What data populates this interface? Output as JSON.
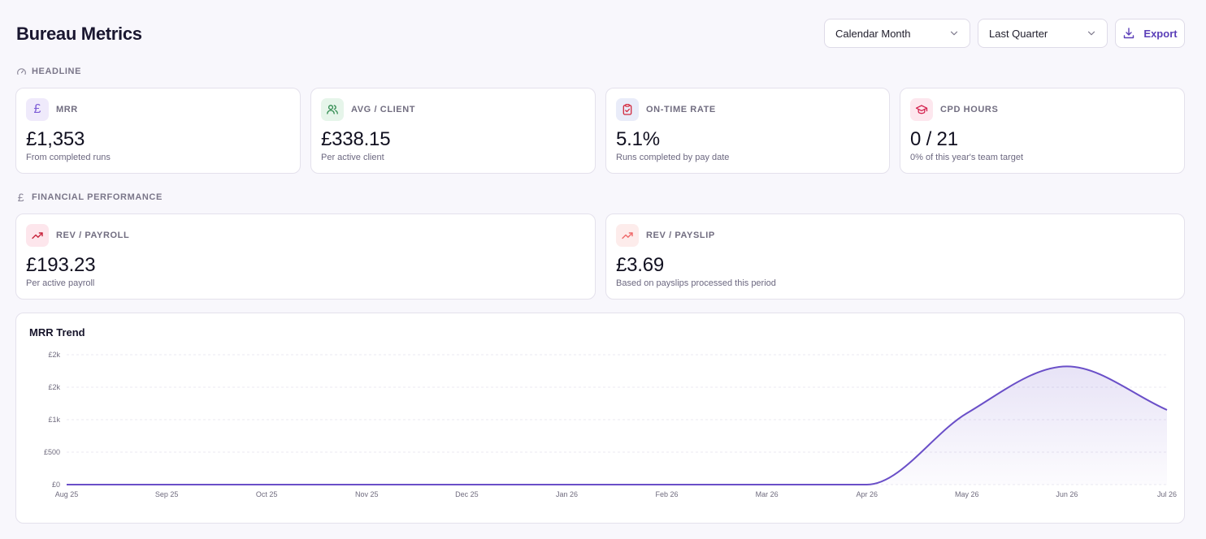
{
  "header": {
    "title": "Bureau Metrics",
    "period_select": "Calendar Month",
    "range_select": "Last Quarter",
    "export_label": "Export"
  },
  "sections": {
    "headline": "HEADLINE",
    "financial": "FINANCIAL PERFORMANCE"
  },
  "headline_cards": [
    {
      "label": "MRR",
      "value": "£1,353",
      "sub": "From completed runs",
      "icon": "pound-icon",
      "color": "#7c5cd6",
      "bg": "#efeafb"
    },
    {
      "label": "AVG / CLIENT",
      "value": "£338.15",
      "sub": "Per active client",
      "icon": "users-icon",
      "color": "#2e8a4e",
      "bg": "#e6f5ea"
    },
    {
      "label": "ON-TIME RATE",
      "value": "5.1%",
      "sub": "Runs completed by pay date",
      "icon": "clipboard-check-icon",
      "color": "#d1283d",
      "bg": "#e9ecf9"
    },
    {
      "label": "CPD HOURS",
      "value": "0 / 21",
      "sub": "0% of this year's team target",
      "icon": "graduation-cap-icon",
      "color": "#d42450",
      "bg": "#fde7ee"
    }
  ],
  "financial_cards": [
    {
      "label": "REV / PAYROLL",
      "value": "£193.23",
      "sub": "Per active payroll",
      "icon": "trending-up-icon",
      "color": "#c8243c",
      "bg": "#fde6ec"
    },
    {
      "label": "REV / PAYSLIP",
      "value": "£3.69",
      "sub": "Based on payslips processed this period",
      "icon": "trending-up-icon",
      "color": "#ef6a6a",
      "bg": "#fdeceb"
    }
  ],
  "chart": {
    "title": "MRR Trend",
    "line_color": "#6a4fc8"
  },
  "chart_data": {
    "type": "area",
    "title": "MRR Trend",
    "x": [
      "Aug 25",
      "Sep 25",
      "Oct 25",
      "Nov 25",
      "Dec 25",
      "Jan 26",
      "Feb 26",
      "Mar 26",
      "Apr 26",
      "May 26",
      "Jun 26",
      "Jul 26"
    ],
    "y_tick_labels": [
      "£0",
      "£500",
      "£1k",
      "£2k",
      "£2k"
    ],
    "y_tick_values": [
      0,
      500,
      1000,
      1500,
      2000
    ],
    "ylim": [
      0,
      2000
    ],
    "series": [
      {
        "values": [
          0,
          0,
          0,
          0,
          0,
          0,
          0,
          0,
          0,
          1100,
          1820,
          1150
        ]
      }
    ],
    "grid": "horizontal-dashed",
    "legend": "none"
  }
}
